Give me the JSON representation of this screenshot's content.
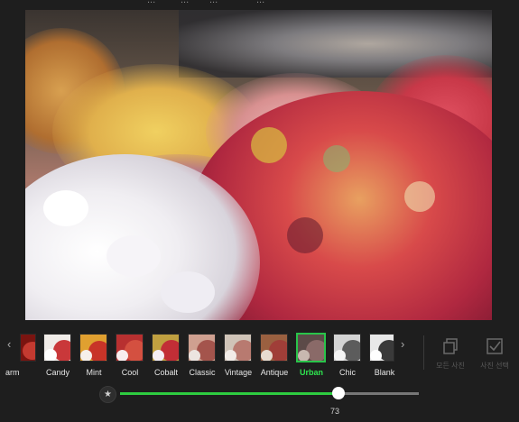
{
  "top_menu": [
    "...",
    "...",
    "...",
    "..."
  ],
  "filters": [
    {
      "label": "arm",
      "colors": [
        "#7a1410",
        "#c43a30",
        "#e8b8a0"
      ],
      "selected": false
    },
    {
      "label": "Candy",
      "colors": [
        "#f0ece8",
        "#c9383a",
        "#e07060"
      ],
      "selected": false
    },
    {
      "label": "Mint",
      "colors": [
        "#e0a030",
        "#c83428",
        "#e9c9a0"
      ],
      "selected": false
    },
    {
      "label": "Cool",
      "colors": [
        "#b83030",
        "#d45040",
        "#f0d0c0"
      ],
      "selected": false
    },
    {
      "label": "Cobalt",
      "colors": [
        "#c0a040",
        "#c22e36",
        "#e8a08c"
      ],
      "selected": false
    },
    {
      "label": "Classic",
      "colors": [
        "#cfa090",
        "#a4544c",
        "#e8d8d0"
      ],
      "selected": false
    },
    {
      "label": "Vintage",
      "colors": [
        "#d0c4b8",
        "#b87a70",
        "#e4b8a8"
      ],
      "selected": false
    },
    {
      "label": "Antique",
      "colors": [
        "#9a6040",
        "#a03e38",
        "#e0c0a0"
      ],
      "selected": false
    },
    {
      "label": "Urban",
      "colors": [
        "#5c4a48",
        "#8a6a68",
        "#c8b8b0"
      ],
      "selected": true
    },
    {
      "label": "Chic",
      "colors": [
        "#d4d4d4",
        "#5c5c5c",
        "#9a9a9a"
      ],
      "selected": false
    },
    {
      "label": "Blank",
      "colors": [
        "#e8e8e8",
        "#3a3a3a",
        "#808080"
      ],
      "selected": false
    }
  ],
  "tools": [
    {
      "icon": "copy-icon",
      "label": "모든 사진"
    },
    {
      "icon": "checkbox-icon",
      "label": "사진 선택"
    }
  ],
  "slider": {
    "value": 73,
    "min": 0,
    "max": 100,
    "value_text": "73",
    "accent": "#2ecc40"
  },
  "accent": "#2ee54f"
}
